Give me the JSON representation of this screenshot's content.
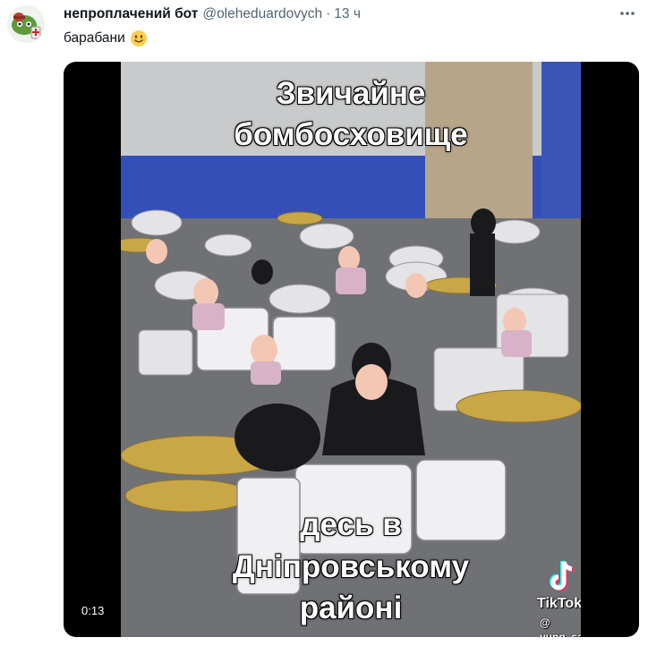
{
  "author": {
    "name": "непроплачений бот",
    "handle": "@oleheduardovych",
    "separator": "·",
    "time": "13 ч",
    "avatar_icon": "frog-avatar-icon"
  },
  "tweet": {
    "text": "барабани",
    "emoji": "slightly-smiling-face-emoji"
  },
  "media": {
    "caption_top": [
      "Звичайне",
      "бомбосховище"
    ],
    "caption_bottom": [
      "десь в",
      "Дніпровському",
      "районі"
    ],
    "watermark_brand": "TikTok",
    "watermark_user": "@ yung_sashko",
    "duration": "0:13"
  },
  "icons": {
    "more": "more-options-icon",
    "tiktok": "tiktok-logo-icon"
  },
  "colors": {
    "text_primary": "#0f1419",
    "text_secondary": "#536471",
    "media_background": "#000000"
  }
}
